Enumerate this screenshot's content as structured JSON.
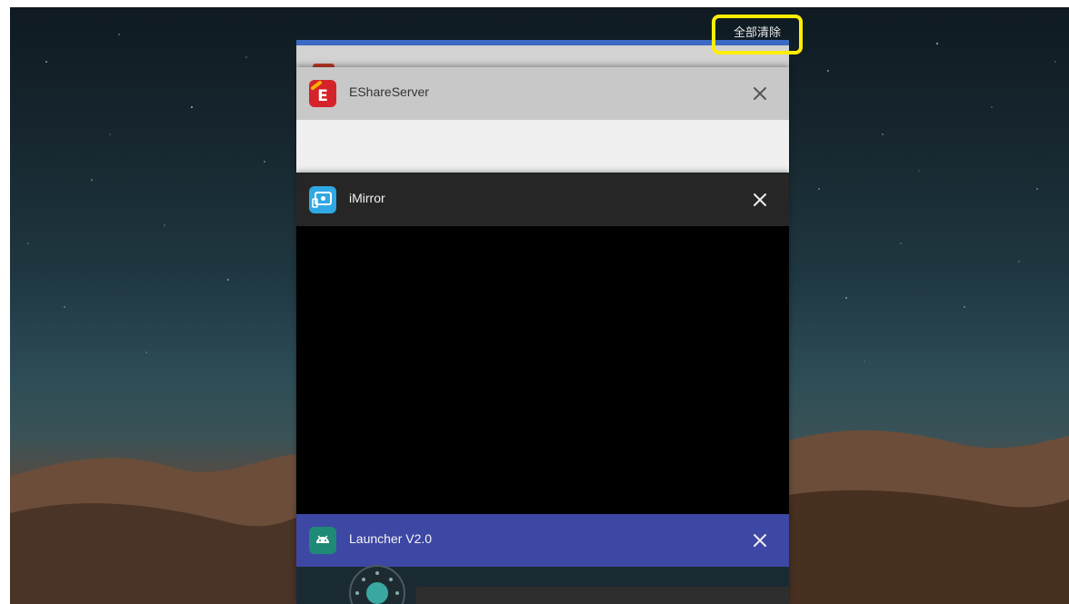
{
  "recents": {
    "clear_all_label": "全部清除",
    "cards": [
      {
        "app_name": "EShareServer",
        "icon": "eshare-icon",
        "icon_letter": "E",
        "color": "#d5232a"
      },
      {
        "app_name": "iMirror",
        "icon": "imirror-icon",
        "color": "#2fa8e4"
      },
      {
        "app_name": "Launcher V2.0",
        "icon": "android-icon",
        "color": "#3d47a4"
      }
    ]
  },
  "colors": {
    "highlight_border": "#ffee00",
    "top_card_accent": "#3b69c4"
  }
}
